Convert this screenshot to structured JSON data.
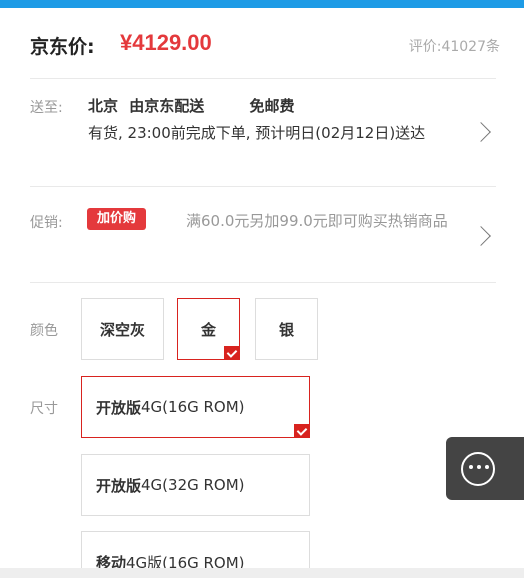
{
  "header": {
    "price_label": "京东价:",
    "price": "¥4129.00",
    "review_label": "评价:",
    "review_count": "41027条"
  },
  "delivery": {
    "label": "送至:",
    "location": "北京",
    "shipper": "由京东配送",
    "shipping_fee": "免邮费",
    "status_text": "有货, 23:00前完成下单, 预计明日(02月12日)送达"
  },
  "promotion": {
    "label": "促销:",
    "badge": "加价购",
    "text": "满60.0元另加99.0元即可购买热销商品"
  },
  "color": {
    "label": "颜色",
    "options": [
      "深空灰",
      "金",
      "银"
    ],
    "selected": "金"
  },
  "size": {
    "label": "尺寸",
    "options": [
      {
        "edition": "开放版",
        "spec": "4G(16G ROM)"
      },
      {
        "edition": "开放版",
        "spec": "4G(32G ROM)"
      },
      {
        "edition": "移动",
        "spec": "4G版(16G ROM)"
      }
    ],
    "selected_index": 0
  },
  "colors": {
    "accent": "#e4393c",
    "top_bar": "#1e9be6"
  },
  "icons": {
    "more": "more-dots-icon",
    "chevron": "chevron-right-icon",
    "check": "checkmark-icon"
  }
}
